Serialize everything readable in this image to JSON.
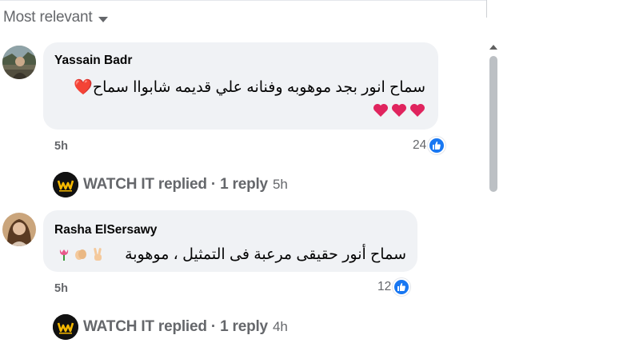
{
  "sort": {
    "label": "Most relevant"
  },
  "comments": [
    {
      "author": "Yassain Badr",
      "text": "سماح انور بجد موهوبه وفنانه علي قديمه شابواا سماح❤️",
      "time": "5h",
      "likes": "24",
      "reply": {
        "label": "WATCH IT replied · 1 reply",
        "time": "5h"
      }
    },
    {
      "author": "Rasha ElSersawy",
      "text": "سماح أنور حقيقى مرعبة فى التمثيل ، موهوبة",
      "time": "5h",
      "likes": "12",
      "reply": {
        "label": "WATCH IT replied · 1 reply",
        "time": "4h"
      }
    }
  ],
  "icons": {
    "like": "like-thumb-icon",
    "heart": "red-heart-icon",
    "sort": "caret-down-icon"
  },
  "colors": {
    "like_blue": "#1877f2",
    "bubble": "#f0f2f5",
    "meta_gray": "#65676b"
  }
}
